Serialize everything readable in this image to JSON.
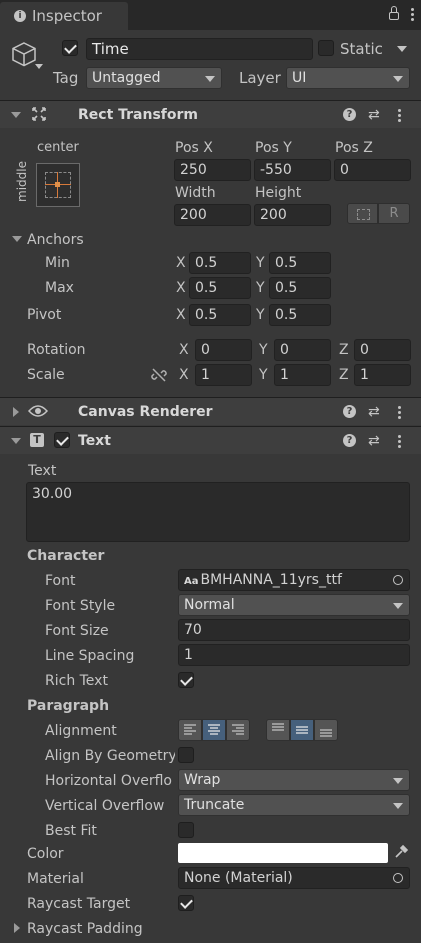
{
  "tab": {
    "icon": "info-icon",
    "label": "Inspector"
  },
  "object": {
    "active": true,
    "name": "Time",
    "static_label": "Static",
    "static_checked": false,
    "tag_label": "Tag",
    "tag_value": "Untagged",
    "layer_label": "Layer",
    "layer_value": "UI"
  },
  "rect_transform": {
    "title": "Rect Transform",
    "anchor_preset_h": "center",
    "anchor_preset_v": "middle",
    "pos_x_label": "Pos X",
    "pos_x": "250",
    "pos_y_label": "Pos Y",
    "pos_y": "-550",
    "pos_z_label": "Pos Z",
    "pos_z": "0",
    "width_label": "Width",
    "width": "200",
    "height_label": "Height",
    "height": "200",
    "r_button": "R",
    "anchors_label": "Anchors",
    "min_label": "Min",
    "min_x": "0.5",
    "min_y": "0.5",
    "max_label": "Max",
    "max_x": "0.5",
    "max_y": "0.5",
    "pivot_label": "Pivot",
    "pivot_x": "0.5",
    "pivot_y": "0.5",
    "rotation_label": "Rotation",
    "rot_x": "0",
    "rot_y": "0",
    "rot_z": "0",
    "scale_label": "Scale",
    "scale_x": "1",
    "scale_y": "1",
    "scale_z": "1",
    "x": "X",
    "y": "Y",
    "z": "Z"
  },
  "canvas_renderer": {
    "title": "Canvas Renderer"
  },
  "text_component": {
    "title": "Text",
    "enabled": true,
    "text_label": "Text",
    "text_value": "30.00",
    "character_label": "Character",
    "font_label": "Font",
    "font_value": "BMHANNA_11yrs_ttf",
    "font_prefix": "Aa",
    "font_style_label": "Font Style",
    "font_style_value": "Normal",
    "font_size_label": "Font Size",
    "font_size_value": "70",
    "line_spacing_label": "Line Spacing",
    "line_spacing_value": "1",
    "rich_text_label": "Rich Text",
    "rich_text": true,
    "paragraph_label": "Paragraph",
    "alignment_label": "Alignment",
    "align_by_geometry_label": "Align By Geometry",
    "align_by_geometry": false,
    "h_overflow_label": "Horizontal Overflo",
    "h_overflow_value": "Wrap",
    "v_overflow_label": "Vertical Overflow",
    "v_overflow_value": "Truncate",
    "best_fit_label": "Best Fit",
    "best_fit": false,
    "color_label": "Color",
    "color_value": "#ffffff",
    "material_label": "Material",
    "material_value": "None (Material)",
    "raycast_target_label": "Raycast Target",
    "raycast_target": true,
    "raycast_padding_label": "Raycast Padding"
  },
  "colors": {
    "bg": "#383838",
    "header": "#3e3e3e",
    "field": "#2a2a2a",
    "accent": "#46607c"
  }
}
